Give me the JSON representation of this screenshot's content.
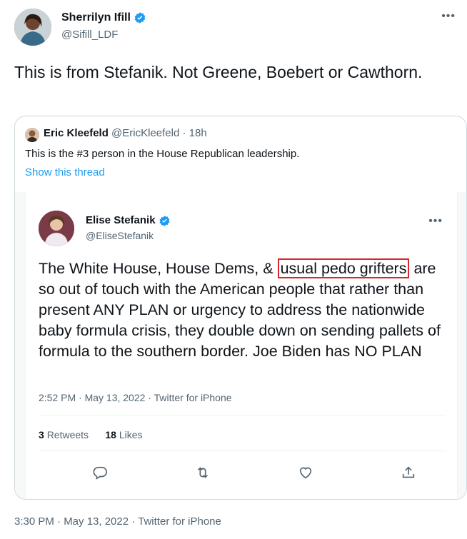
{
  "main": {
    "author_name": "Sherrilyn Ifill",
    "author_handle": "@Sifill_LDF",
    "text": "This is from Stefanik. Not Greene, Boebert or Cawthorn.",
    "timestamp": "3:30 PM · May 13, 2022 · Twitter for iPhone"
  },
  "quote": {
    "author_name": "Eric Kleefeld",
    "author_handle": "@EricKleefeld",
    "time": "· 18h",
    "text": "This is the #3 person in the House Republican leadership.",
    "show_thread": "Show this thread"
  },
  "embedded": {
    "author_name": "Elise Stefanik",
    "author_handle": "@EliseStefanik",
    "text_before": "The White House, House Dems, & ",
    "text_highlight": "usual pedo grifters",
    "text_after": " are so out of touch with the American people that rather than present ANY PLAN or urgency to address the nationwide baby formula crisis, they double down on sending pallets of formula to the southern border. Joe Biden has NO PLAN",
    "meta": "2:52 PM · May 13, 2022 · Twitter for iPhone",
    "retweets_count": "3",
    "retweets_label": "Retweets",
    "likes_count": "18",
    "likes_label": "Likes"
  },
  "colors": {
    "link": "#1d9bf0",
    "verified": "#1d9bf0",
    "highlight_box": "#d9262c",
    "secondary_text": "#536471"
  },
  "icons": [
    "verified-badge-icon",
    "more-icon",
    "reply-icon",
    "retweet-icon",
    "like-icon",
    "share-icon"
  ]
}
